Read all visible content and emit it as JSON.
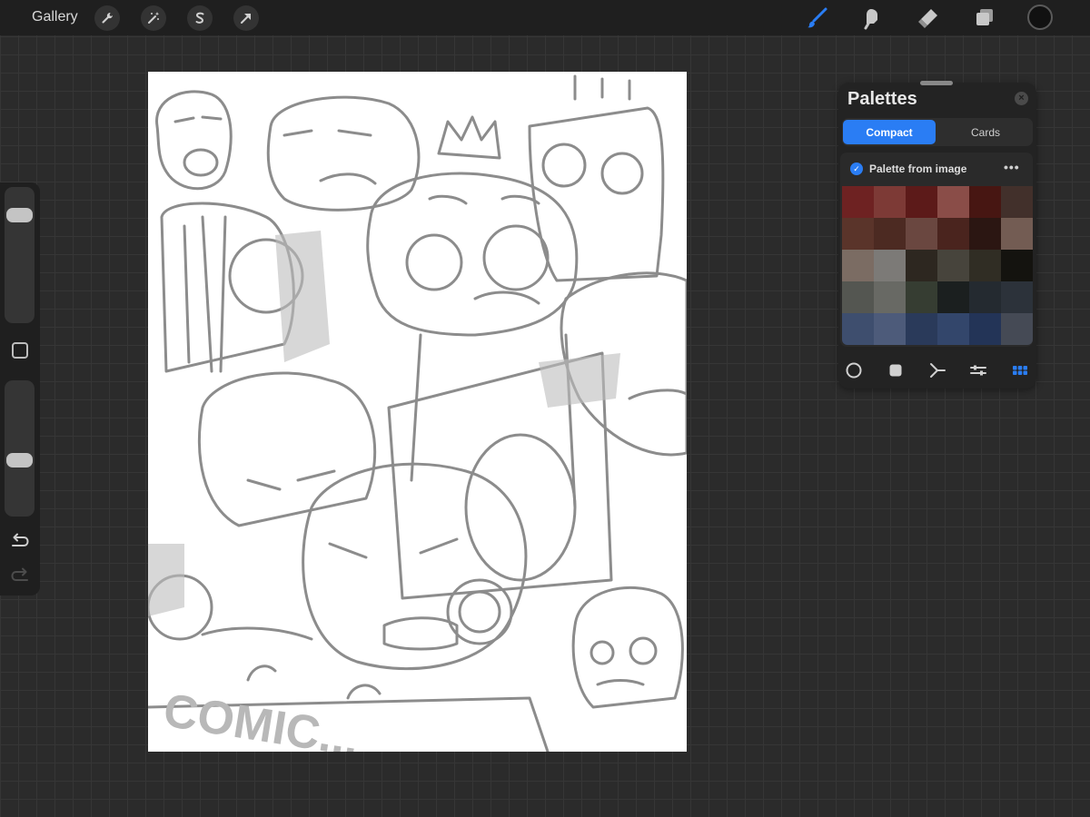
{
  "app": {
    "gallery_label": "Gallery"
  },
  "toolbar": {
    "left_tools": [
      {
        "icon": "wrench-icon"
      },
      {
        "icon": "magic-wand-icon"
      },
      {
        "icon": "selection-s-icon"
      },
      {
        "icon": "transform-arrow-icon"
      }
    ],
    "right_tools": [
      {
        "icon": "brush-icon",
        "active": true
      },
      {
        "icon": "smudge-icon"
      },
      {
        "icon": "eraser-icon"
      },
      {
        "icon": "layers-icon"
      }
    ],
    "current_color": "#111111",
    "active_color": "#2a7df4"
  },
  "sidebar": {
    "brush_size_level": 0.85,
    "opacity_level": 0.4,
    "modify_icon": "square-icon",
    "undo_icon": "undo-icon",
    "redo_icon": "redo-icon"
  },
  "canvas": {
    "sketch_text": "COMIC..."
  },
  "palettes": {
    "title": "Palettes",
    "tabs": [
      {
        "label": "Compact",
        "active": true
      },
      {
        "label": "Cards",
        "active": false
      }
    ],
    "palette": {
      "name": "Palette from image",
      "more_label": "•••",
      "swatches": [
        "#6e2222",
        "#7d3a36",
        "#5c1a19",
        "#8a4d48",
        "#471612",
        "#42302b",
        "#5a342a",
        "#4c2a22",
        "#6a4740",
        "#4a241e",
        "#2b1612",
        "#735c53",
        "#7b6c63",
        "#7c7a77",
        "#2d2720",
        "#47443c",
        "#302d24",
        "#14130f",
        "#545651",
        "#686964",
        "#363d32",
        "#1b1f1f",
        "#242a30",
        "#2c323a",
        "#3e4e6e",
        "#4d5b7a",
        "#2a3a5a",
        "#33466b",
        "#233457",
        "#454a55"
      ]
    },
    "footer_icons": [
      {
        "icon": "disc-icon"
      },
      {
        "icon": "classic-square-icon"
      },
      {
        "icon": "harmony-icon"
      },
      {
        "icon": "value-sliders-icon"
      },
      {
        "icon": "palettes-grid-icon",
        "active": true
      }
    ]
  }
}
